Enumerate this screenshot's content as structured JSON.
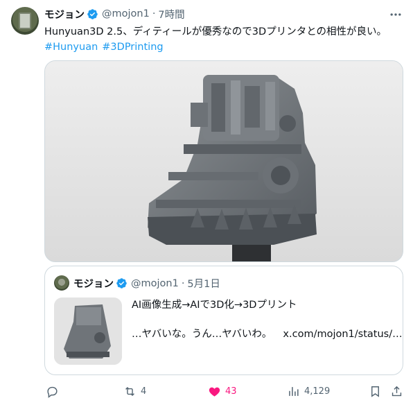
{
  "tweet": {
    "author_name": "モジョン",
    "handle": "@mojon1",
    "separator": "·",
    "time": "7時間",
    "text": "Hunyuan3D 2.5、ディティールが優秀なので3Dプリンタとの相性が良い。",
    "hashtags": [
      "#Hunyuan",
      "#3DPrinting"
    ]
  },
  "quote": {
    "author_name": "モジョン",
    "handle": "@mojon1",
    "separator": "·",
    "date": "5月1日",
    "line1": "AI画像生成→AIで3D化→3Dプリント",
    "line2": "…ヤバいな。うん…ヤバいわ。",
    "link": "x.com/mojon1/status/…"
  },
  "actions": {
    "reply_count": "",
    "retweet_count": "4",
    "like_count": "43",
    "views_count": "4,129"
  },
  "colors": {
    "accent": "#1d9bf0",
    "like": "#f91880",
    "secondary_text": "#536471",
    "border": "#cfd9de"
  },
  "icons": [
    "verified-badge-icon",
    "more-icon",
    "reply-icon",
    "retweet-icon",
    "heart-icon",
    "views-icon",
    "bookmark-icon",
    "share-icon"
  ]
}
